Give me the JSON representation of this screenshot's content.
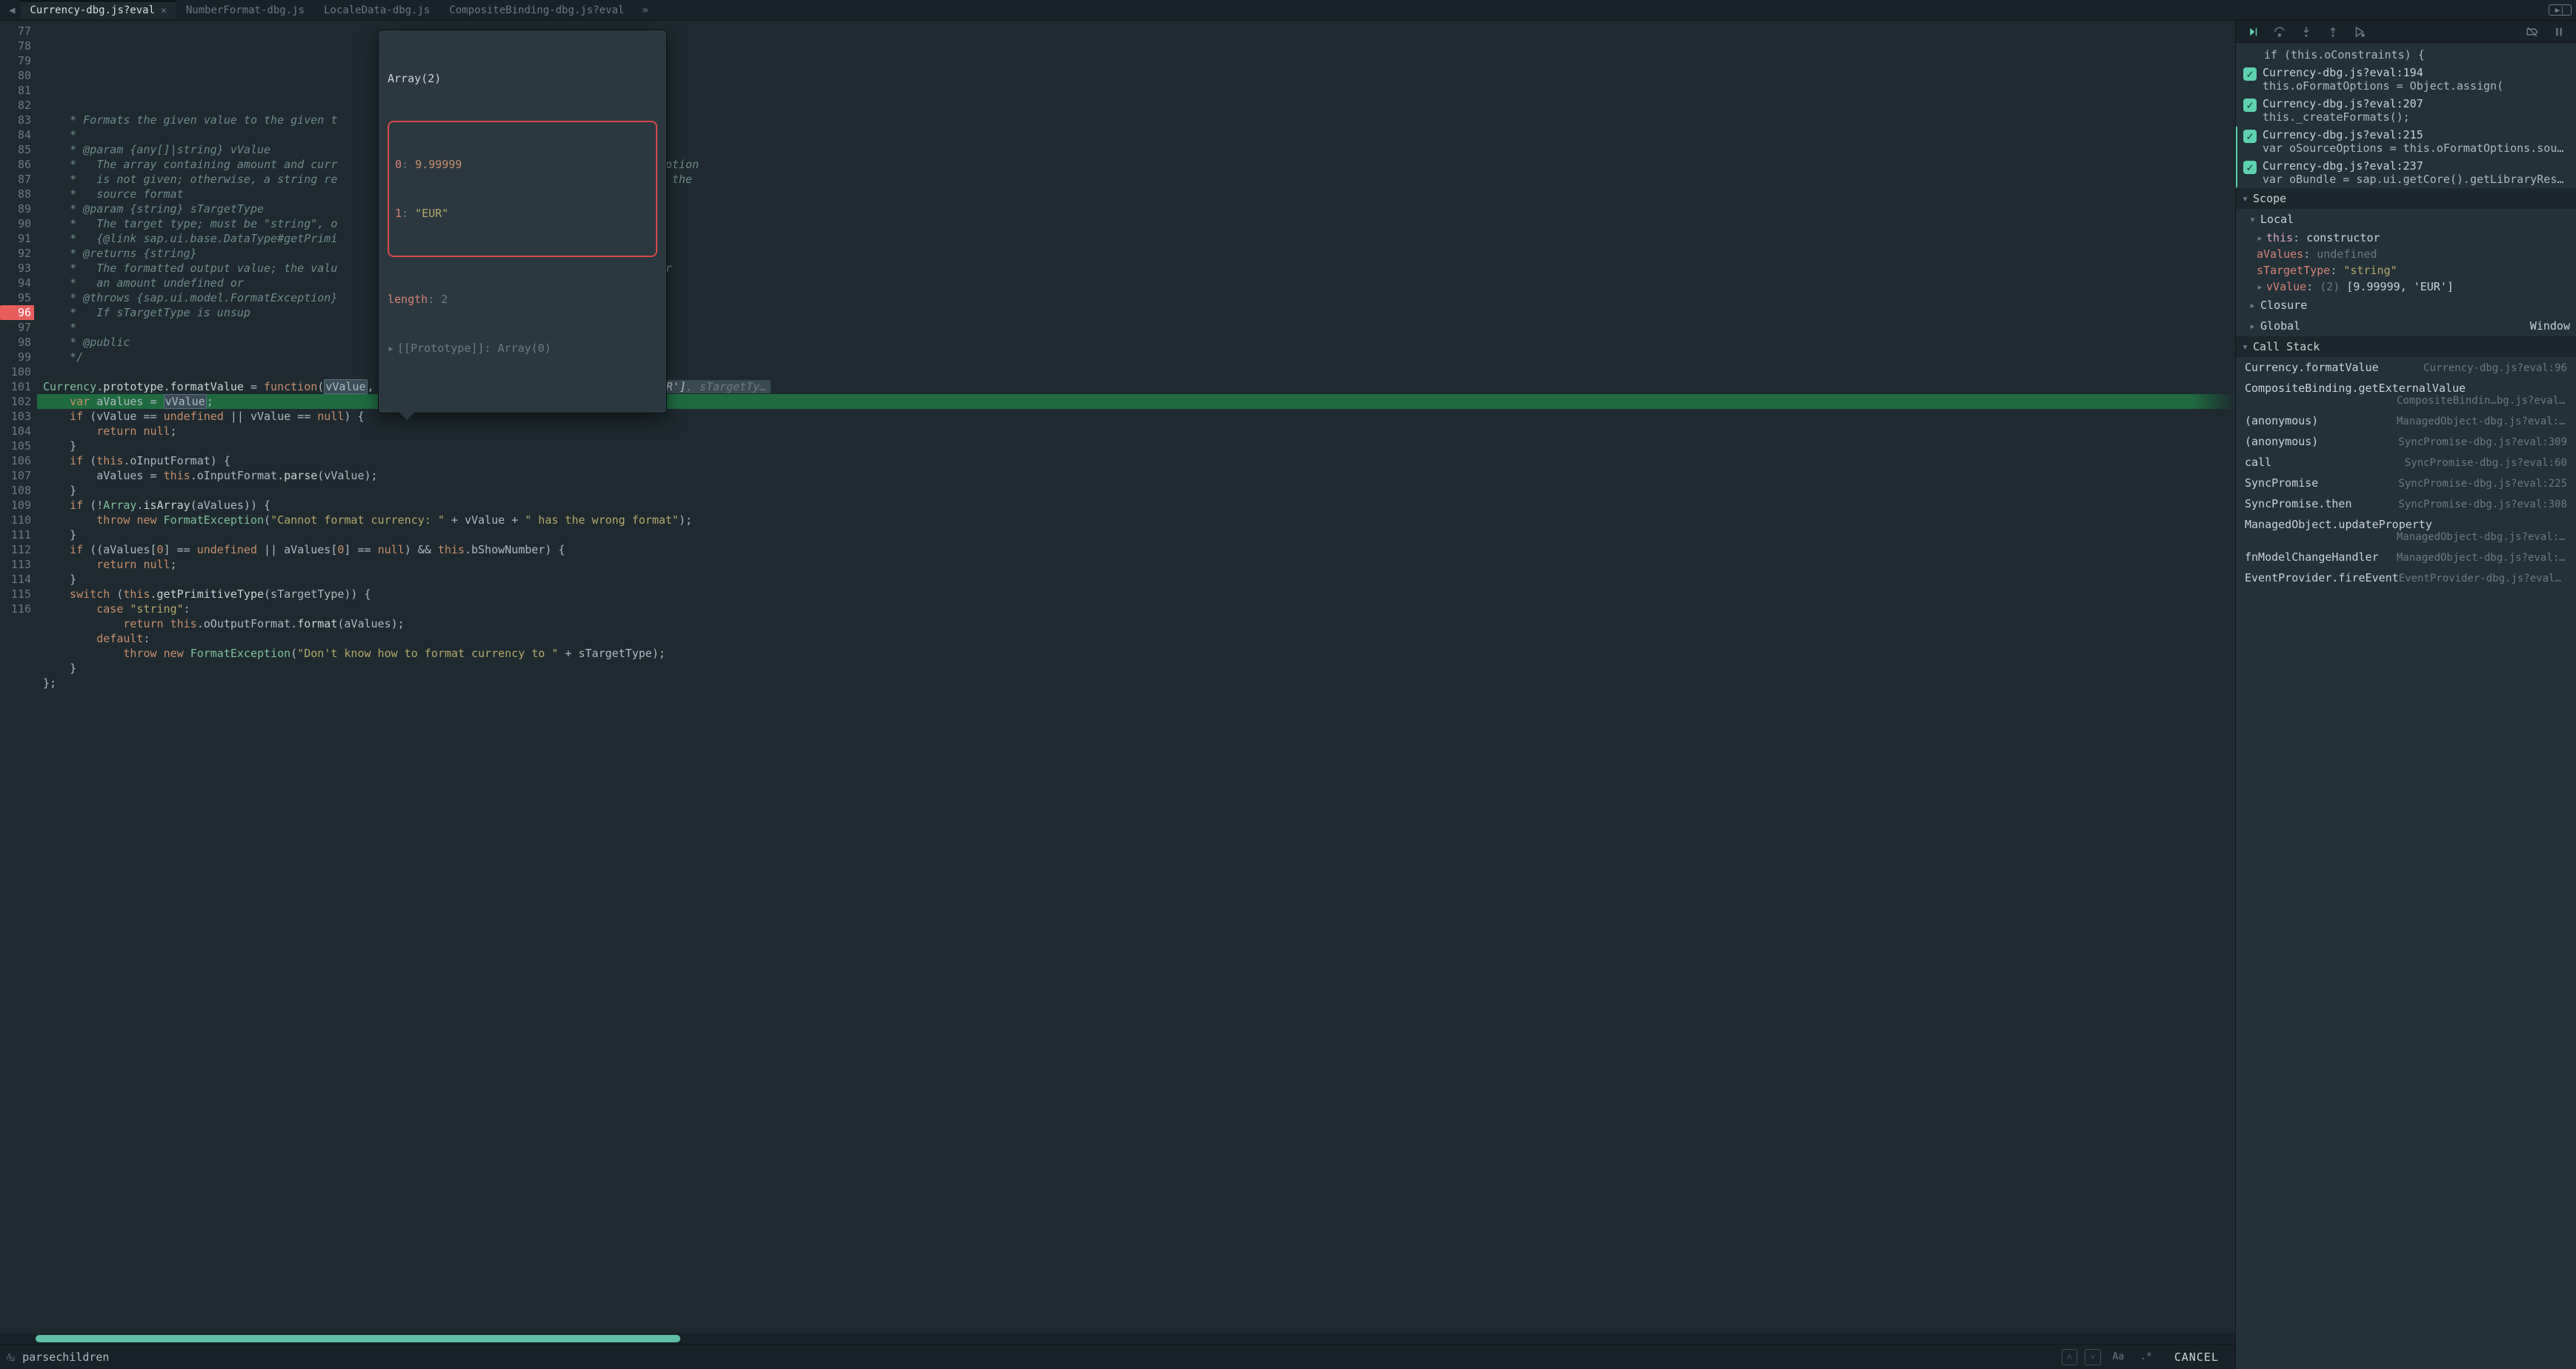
{
  "tabs": {
    "nav_prev": "◀",
    "items": [
      {
        "label": "Currency-dbg.js?eval",
        "active": true,
        "closable": true
      },
      {
        "label": "NumberFormat-dbg.js",
        "active": false,
        "closable": false
      },
      {
        "label": "LocaleData-dbg.js",
        "active": false,
        "closable": false
      },
      {
        "label": "CompositeBinding-dbg.js?eval",
        "active": false,
        "closable": false
      }
    ],
    "more": "»",
    "run": "▶|"
  },
  "tooltip": {
    "header": "Array(2)",
    "row0_key": "0",
    "row0_val": "9.99999",
    "row1_key": "1",
    "row1_val": "\"EUR\"",
    "length_key": "length",
    "length_val": "2",
    "proto_key": "[[Prototype]]",
    "proto_val": "Array(0)"
  },
  "gutter_start": 77,
  "gutter_end": 116,
  "breakpoint_line": 96,
  "code": {
    "l77": " * Formats the given value to the given t",
    "l78": " *",
    "l79": " * @param {any[]|string} vValue",
    "l80": " *   The array containing amount and curr",
    "l80b": "format option",
    "l81": " *   is not given; otherwise, a string re",
    "l81b": "using the",
    "l82": " *   source format",
    "l83": " * @param {string} sTargetType",
    "l84": " *   The target type; must be \"string\", o",
    "l85": " *   {@link sap.ui.base.DataType#getPrimi",
    "l86": " * @returns {string}",
    "l87": " *   The formatted output value; the valu",
    "l87b": "ode> or",
    "l88": " *   an amount <code>undefined</code> or",
    "l88b": "ull</code>",
    "l89": " * @throws {sap.ui.model.FormatException}",
    "l90": " *   If <code>sTargetType</code> is unsup",
    "l91": " *",
    "l92": " * @public",
    "l93": " */",
    "inline95_a": "vValue = ",
    "inline95_b": "(2) [9.99999, 'EUR']",
    "inline95_c": ", sTargetTy…"
  },
  "search": {
    "icon": "A͟ᵦ",
    "value": "parsechildren",
    "prev": "˄",
    "next": "˅",
    "case": "Aa",
    "regex": ".*",
    "cancel": "CANCEL"
  },
  "debugger": {
    "toolbar": {
      "resume": "resume",
      "step_over": "step-over",
      "step_into": "step-into",
      "step_out": "step-out",
      "step": "step",
      "deactivate": "deactivate",
      "pause_exc": "pause-exc"
    },
    "bp_pre_line": "if (this.oConstraints) {",
    "bp": [
      {
        "loc": "Currency-dbg.js?eval:194",
        "snip": "this.oFormatOptions = Object.assign("
      },
      {
        "loc": "Currency-dbg.js?eval:207",
        "snip": "this._createFormats();"
      },
      {
        "loc": "Currency-dbg.js?eval:215",
        "snip": "var oSourceOptions = this.oFormatOptions.sou…"
      },
      {
        "loc": "Currency-dbg.js?eval:237",
        "snip": "var oBundle = sap.ui.getCore().getLibraryRes…"
      }
    ],
    "scope_hdr": "Scope",
    "local_hdr": "Local",
    "local": {
      "this_k": "this",
      "this_v": "constructor",
      "aValues_k": "aValues",
      "aValues_v": "undefined",
      "sTargetType_k": "sTargetType",
      "sTargetType_v": "\"string\"",
      "vValue_k": "vValue",
      "vValue_v_a": "(2) ",
      "vValue_v_b": "[9.99999, 'EUR']"
    },
    "closure_hdr": "Closure",
    "global_hdr": "Global",
    "global_val": "Window",
    "callstack_hdr": "Call Stack",
    "stack": [
      {
        "fn": "Currency.formatValue",
        "src": "Currency-dbg.js?eval:96"
      },
      {
        "fn": "CompositeBinding.getExternalValue",
        "src": "CompositeBindin…bg.js?eval:270",
        "two": true
      },
      {
        "fn": "(anonymous)",
        "src": "ManagedObject-dbg.js?eval:3657"
      },
      {
        "fn": "(anonymous)",
        "src": "SyncPromise-dbg.js?eval:309"
      },
      {
        "fn": "call",
        "src": "SyncPromise-dbg.js?eval:60"
      },
      {
        "fn": "SyncPromise",
        "src": "SyncPromise-dbg.js?eval:225"
      },
      {
        "fn": "SyncPromise.then",
        "src": "SyncPromise-dbg.js?eval:308"
      },
      {
        "fn": "ManagedObject.updateProperty",
        "src": "ManagedObject-dbg.js?eval:3656",
        "two": true
      },
      {
        "fn": "fnModelChangeHandler",
        "src": "ManagedObject-dbg.js?eval:3436"
      },
      {
        "fn": "EventProvider.fireEvent",
        "src": "EventProvider-dbg.js?eval:247"
      }
    ]
  }
}
